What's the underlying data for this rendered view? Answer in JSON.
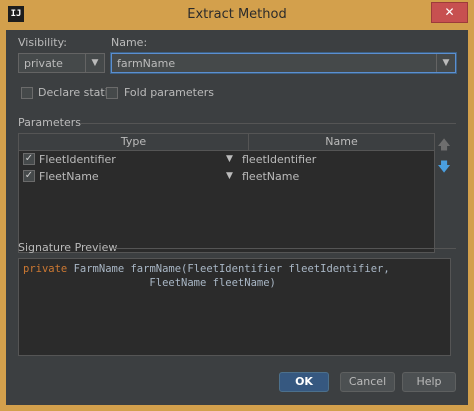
{
  "window": {
    "title": "Extract Method",
    "app_icon": "IJ",
    "close_glyph": "✕"
  },
  "visibility": {
    "label": "Visibility:",
    "value": "private"
  },
  "name": {
    "label": "Name:",
    "value": "farmName"
  },
  "options": {
    "declare_static": "Declare static",
    "fold_parameters": "Fold parameters"
  },
  "parameters": {
    "label": "Parameters",
    "columns": [
      "Type",
      "Name"
    ],
    "rows": [
      {
        "type": "FleetIdentifier",
        "name": "fleetIdentifier",
        "checked": true
      },
      {
        "type": "FleetName",
        "name": "fleetName",
        "checked": true
      }
    ],
    "move_up_icon": "arrow-up-icon",
    "move_down_icon": "arrow-down-icon"
  },
  "signature": {
    "label": "Signature Preview",
    "line1_keyword": "private",
    "line1_rest": " FarmName farmName(FleetIdentifier fleetIdentifier,",
    "line2": "                    FleetName fleetName)"
  },
  "buttons": {
    "ok": "OK",
    "cancel": "Cancel",
    "help": "Help"
  }
}
